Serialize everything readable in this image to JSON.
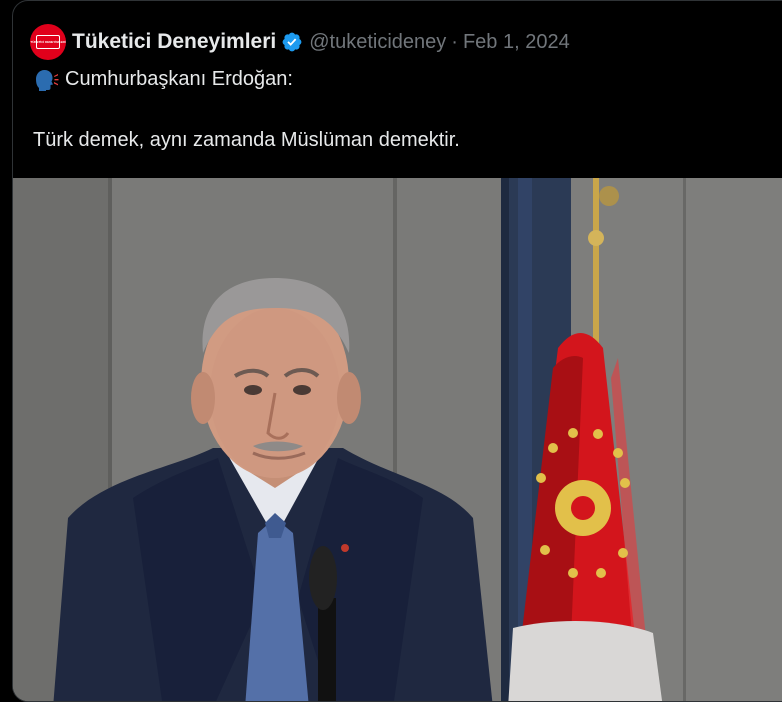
{
  "tweet": {
    "display_name": "Tüketici Deneyimleri",
    "handle": "@tuketicideney",
    "separator": "·",
    "date": "Feb 1, 2024",
    "avatar_text": "TÜKETİCİ DENEYİMLERİ",
    "lines": [
      "Cumhurbaşkanı Erdoğan:",
      "Türk demek, aynı zamanda Müslüman demektir."
    ],
    "line1_icon": "speaking-head-icon",
    "verified_icon": "verified-badge-icon"
  },
  "colors": {
    "background": "#000000",
    "text": "#e7e9ea",
    "muted": "#71767b",
    "verified": "#1d9bf0",
    "avatar": "#e0001b",
    "flag_red": "#d3151c"
  },
  "photo": {
    "subject": "press-photo"
  }
}
